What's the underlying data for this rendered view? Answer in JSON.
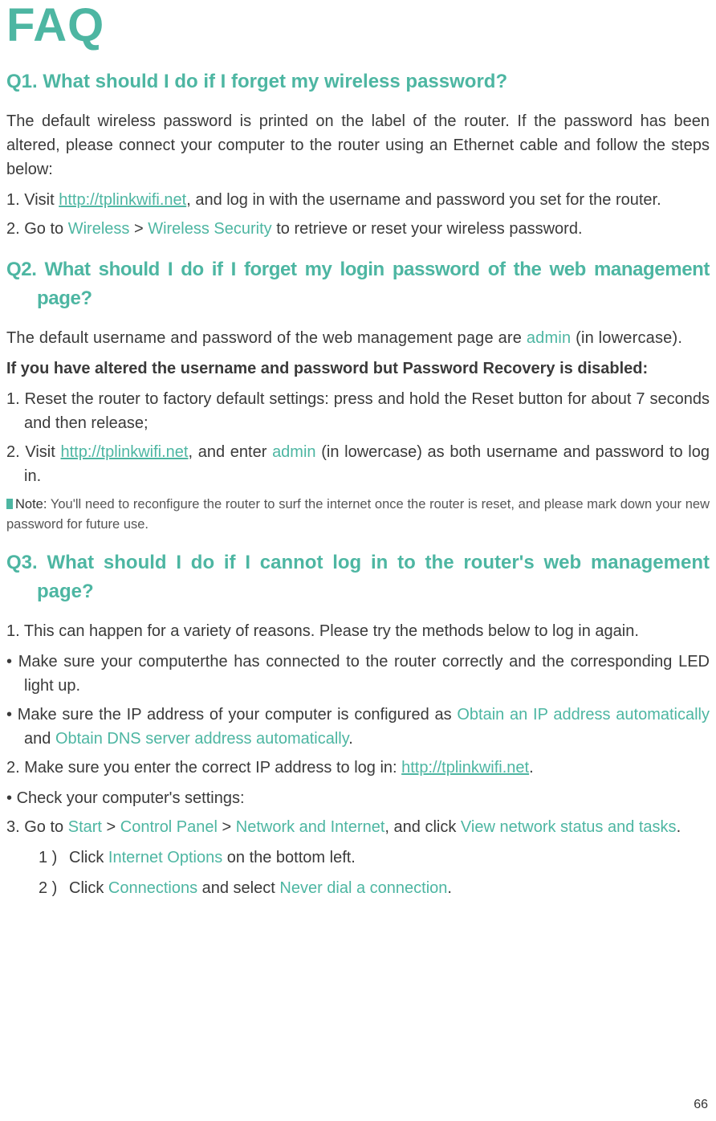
{
  "page_number": "66",
  "title": "FAQ",
  "q1": {
    "label": "Q1.",
    "text": "What should I do if I forget my wireless password?",
    "intro": "The default wireless password is printed on the label of the router. If the password has been altered, please connect your computer to the router using an Ethernet cable and follow the steps below:",
    "step1_num": "1. ",
    "step1_pre": "Visit ",
    "link1": "http://tplinkwifi.net",
    "step1_post": ", and log in with the username and password you set for the router.",
    "step2_num": "2. ",
    "step2_a": "Go to ",
    "step2_b": "Wireless",
    "step2_c": " > ",
    "step2_d": "Wireless Security",
    "step2_e": " to retrieve or reset your wireless password."
  },
  "q2": {
    "label": "Q2.",
    "text": "What should I do if I forget my login password of the web management page?",
    "intro_a": "The default username and password of the web management page are ",
    "intro_admin": "admin",
    "intro_b": " (in lowercase).",
    "bold_line": "If you have altered the username and password but Password Recovery is disabled:",
    "step1_num": "1. ",
    "step1": "Reset the router to factory default settings: press and hold the Reset button for about 7 seconds and then release;",
    "step2_num": "2. ",
    "step2_a": "Visit ",
    "link2": "http://tplinkwifi.net",
    "step2_b": ", and enter ",
    "step2_admin": "admin",
    "step2_c": " (in lowercase) as both username and password to log in.",
    "note_label": "Note:",
    "note_text": " You'll need to reconfigure the router to surf the internet once the router is reset, and please mark down your new password for future use."
  },
  "q3": {
    "label": "Q3.",
    "text": "What should I do if I cannot log in to the router's web management page?",
    "step1_num": "1. ",
    "step1": "This can happen for a variety of reasons. Please try the methods below to log in again.",
    "b1": "Make sure your computerthe has connected to the router correctly and the corresponding LED light up.",
    "b2_a": "Make sure the IP address of your computer is configured as ",
    "b2_b": "Obtain an IP address automatically",
    "b2_c": " and ",
    "b2_d": "Obtain DNS server address automatically",
    "b2_e": ".",
    "step2_num": "2. ",
    "step2_a": "Make sure  you enter the correct IP address to log in: ",
    "link3": "http://tplinkwifi.net",
    "step2_b": ".",
    "b3": "Check your computer's settings:",
    "step3_num": "3. ",
    "step3_a": "Go to ",
    "step3_b": "Start",
    "step3_c": " > ",
    "step3_d": "Control Panel",
    "step3_e": " > ",
    "step3_f": "Network and Internet",
    "step3_g": ", and click ",
    "step3_h": "View network status and tasks",
    "step3_i": ".",
    "sub1_num": "1 )",
    "sub1_a": "Click ",
    "sub1_b": "Internet Options",
    "sub1_c": " on the bottom left.",
    "sub2_num": "2 )",
    "sub2_a": "Click ",
    "sub2_b": "Connections",
    "sub2_c": " and select ",
    "sub2_d": "Never dial a connection",
    "sub2_e": "."
  }
}
